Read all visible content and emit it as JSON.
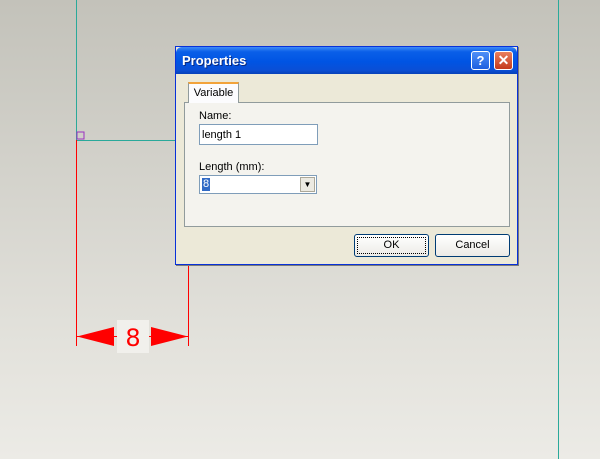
{
  "dialog": {
    "title": "Properties",
    "help_glyph": "?",
    "close_glyph": "✕",
    "tab_label": "Variable",
    "name_label": "Name:",
    "name_value": "length 1",
    "length_label": "Length (mm):",
    "length_value": "8",
    "ok_label": "OK",
    "cancel_label": "Cancel"
  },
  "drawing": {
    "dimension_value": "8",
    "dimension_color": "#ff0000",
    "guide_color": "#2aa99a",
    "marker_color": "#9b30c0"
  }
}
